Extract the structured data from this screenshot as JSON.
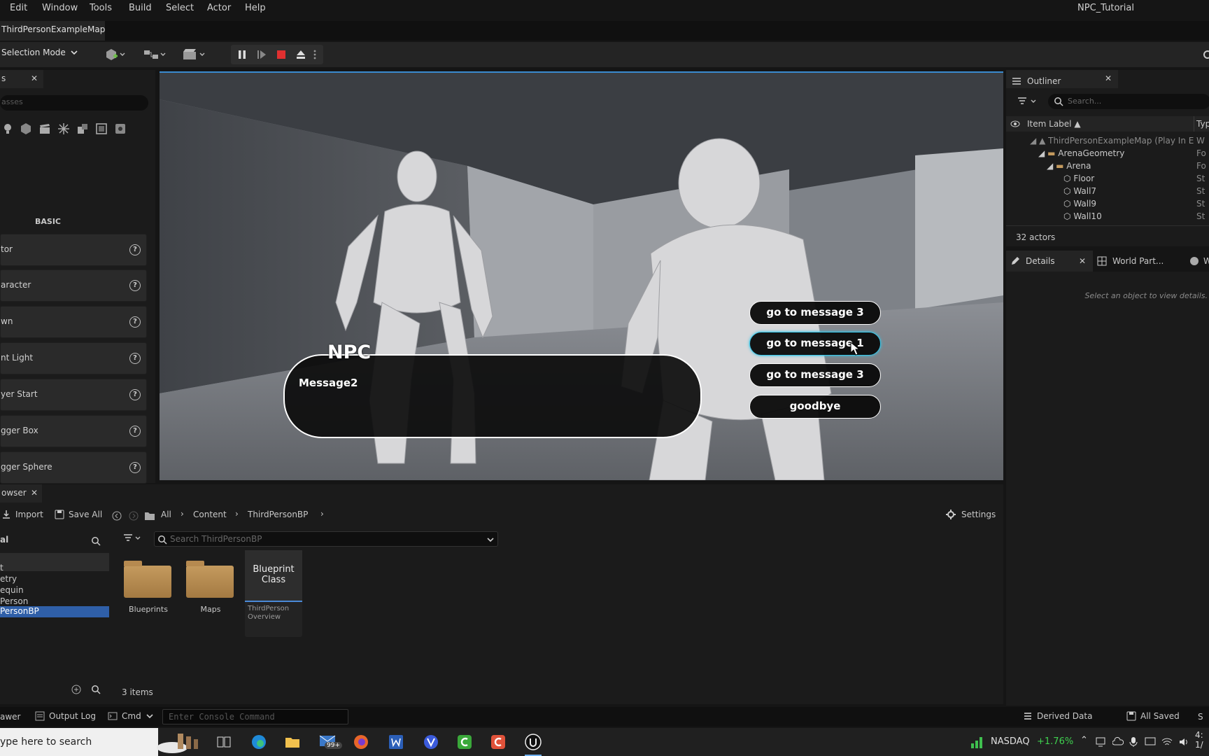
{
  "menu": {
    "items": [
      "Edit",
      "Window",
      "Tools",
      "Build",
      "Select",
      "Actor",
      "Help"
    ],
    "project": "NPC_Tutorial"
  },
  "tabs": {
    "map": "ThirdPersonExampleMap"
  },
  "toolbar": {
    "selection_mode": "Selection Mode"
  },
  "place_actors": {
    "tab_label": "s",
    "search_placeholder": "asses",
    "category": "BASIC",
    "items": [
      {
        "label": "tor"
      },
      {
        "label": "aracter"
      },
      {
        "label": "wn"
      },
      {
        "label": "nt Light"
      },
      {
        "label": "yer Start"
      },
      {
        "label": "gger Box"
      },
      {
        "label": "gger Sphere"
      }
    ]
  },
  "viewport": {
    "speaker": "NPC",
    "message": "Message2",
    "choices": [
      {
        "label": "go to message 3"
      },
      {
        "label": "go to message 1"
      },
      {
        "label": "go to message 3"
      },
      {
        "label": "goodbye"
      }
    ]
  },
  "outliner": {
    "title": "Outliner",
    "search_placeholder": "Search...",
    "col_label": "Item Label",
    "col_type": "Typ",
    "rows": [
      {
        "label": "ThirdPersonExampleMap (Play In E",
        "type": "W"
      },
      {
        "label": "ArenaGeometry",
        "type": "Fo"
      },
      {
        "label": "Arena",
        "type": "Fo"
      },
      {
        "label": "Floor",
        "type": "St"
      },
      {
        "label": "Wall7",
        "type": "St"
      },
      {
        "label": "Wall9",
        "type": "St"
      },
      {
        "label": "Wall10",
        "type": "St"
      }
    ],
    "count": "32 actors"
  },
  "details": {
    "tab": "Details",
    "tab2": "World Part...",
    "tab3": "W",
    "empty": "Select an object to view details."
  },
  "content_browser": {
    "tab": "owser",
    "import": "Import",
    "save_all": "Save All",
    "crumbs": [
      "All",
      "Content",
      "ThirdPersonBP"
    ],
    "settings": "Settings",
    "source_title": "al",
    "sources": [
      "t",
      "etry",
      "equin",
      "Person",
      "PersonBP"
    ],
    "filter_placeholder": "Search ThirdPersonBP",
    "folders": [
      "Blueprints",
      "Maps"
    ],
    "asset_type": "Blueprint Class",
    "asset_name": "ThirdPerson Overview",
    "count": "3 items"
  },
  "status": {
    "drawer": "awer",
    "output_log": "Output Log",
    "cmd": "Cmd",
    "console_placeholder": "Enter Console Command",
    "derived": "Derived Data",
    "saved": "All Saved",
    "trail": "S"
  },
  "taskbar": {
    "search": "ype here to search",
    "mail_badge": "99+",
    "ticker": "NASDAQ",
    "change": "+1.76%",
    "clock": "4:",
    "date": "1/"
  },
  "colors": {
    "accent": "#38c6e8",
    "selection": "#2f5fa8",
    "folder": "#b68a50"
  }
}
